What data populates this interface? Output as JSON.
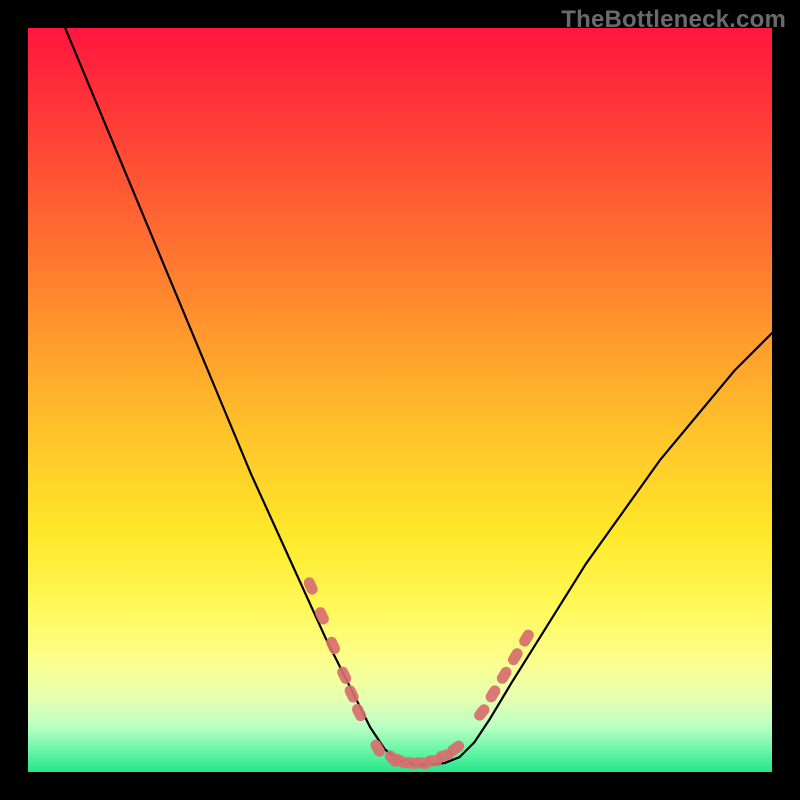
{
  "watermark": "TheBottleneck.com",
  "chart_data": {
    "type": "line",
    "title": "",
    "xlabel": "",
    "ylabel": "",
    "xlim": [
      0,
      100
    ],
    "ylim": [
      0,
      100
    ],
    "grid": false,
    "legend": false,
    "gradient_stops": [
      {
        "pos": 0,
        "color": "#ff163f"
      },
      {
        "pos": 7,
        "color": "#ff2a3a"
      },
      {
        "pos": 22,
        "color": "#ff5a33"
      },
      {
        "pos": 38,
        "color": "#ff8e2e"
      },
      {
        "pos": 54,
        "color": "#ffc22a"
      },
      {
        "pos": 68,
        "color": "#ffe829"
      },
      {
        "pos": 78,
        "color": "#fff95a"
      },
      {
        "pos": 85,
        "color": "#fbff8d"
      },
      {
        "pos": 90,
        "color": "#e7ffb0"
      },
      {
        "pos": 94,
        "color": "#b9ffc4"
      },
      {
        "pos": 97,
        "color": "#6cf6a8"
      },
      {
        "pos": 100,
        "color": "#24e58b"
      }
    ],
    "series": [
      {
        "name": "bottleneck-curve",
        "color": "#000000",
        "x": [
          5,
          10,
          15,
          20,
          25,
          30,
          35,
          40,
          42,
          44,
          46,
          48,
          50,
          52,
          54,
          56,
          58,
          60,
          62,
          65,
          70,
          75,
          80,
          85,
          90,
          95,
          100
        ],
        "y": [
          100,
          88,
          76,
          64,
          52,
          40,
          29,
          18,
          14,
          10,
          6,
          3,
          1.5,
          1,
          1,
          1.2,
          2,
          4,
          7,
          12,
          20,
          28,
          35,
          42,
          48,
          54,
          59
        ]
      }
    ],
    "markers": [
      {
        "name": "left-cluster",
        "color": "#d86e6e",
        "points": [
          {
            "x": 38,
            "y": 25
          },
          {
            "x": 39.5,
            "y": 21
          },
          {
            "x": 41,
            "y": 17
          },
          {
            "x": 42.5,
            "y": 13
          },
          {
            "x": 43.5,
            "y": 10.5
          },
          {
            "x": 44.5,
            "y": 8
          }
        ]
      },
      {
        "name": "bottom-cluster",
        "color": "#d86e6e",
        "points": [
          {
            "x": 47,
            "y": 3.2
          },
          {
            "x": 49,
            "y": 1.8
          },
          {
            "x": 50,
            "y": 1.5
          },
          {
            "x": 51.5,
            "y": 1.2
          },
          {
            "x": 53,
            "y": 1.2
          },
          {
            "x": 54.5,
            "y": 1.5
          },
          {
            "x": 56,
            "y": 2.2
          },
          {
            "x": 57.5,
            "y": 3.2
          }
        ]
      },
      {
        "name": "right-cluster",
        "color": "#d86e6e",
        "points": [
          {
            "x": 61,
            "y": 8
          },
          {
            "x": 62.5,
            "y": 10.5
          },
          {
            "x": 64,
            "y": 13
          },
          {
            "x": 65.5,
            "y": 15.5
          },
          {
            "x": 67,
            "y": 18
          }
        ]
      }
    ]
  }
}
